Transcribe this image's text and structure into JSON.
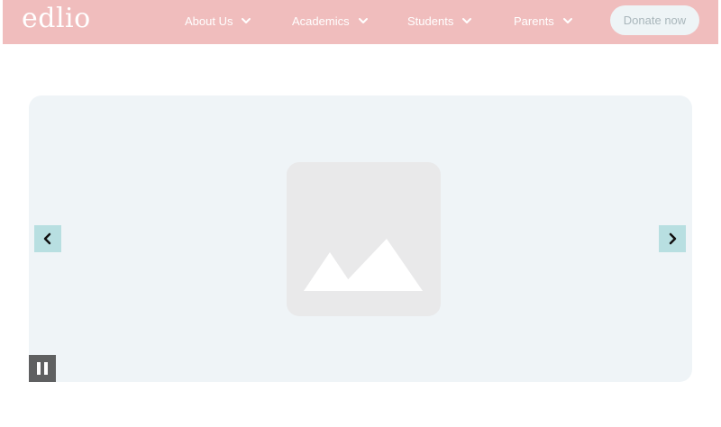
{
  "header": {
    "logo_text": "edlio",
    "nav": [
      {
        "label": "About Us"
      },
      {
        "label": "Academics"
      },
      {
        "label": "Students"
      },
      {
        "label": "Parents"
      }
    ],
    "donate_label": "Donate now",
    "colors": {
      "background": "#f0bdbd",
      "donate_bg": "#eef4f6"
    }
  },
  "slideshow": {
    "placeholder_icon": "image-placeholder-icon",
    "prev_icon": "chevron-left-icon",
    "next_icon": "chevron-right-icon",
    "pause_icon": "pause-icon",
    "colors": {
      "background": "#eff4f7",
      "arrow_bg": "#b8dfe1",
      "pause_bg": "#5f6061"
    }
  }
}
